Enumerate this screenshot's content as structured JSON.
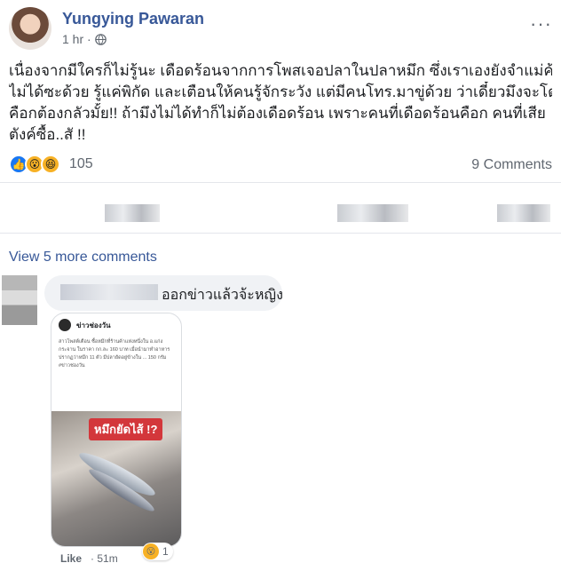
{
  "post": {
    "author": "Yungying Pawaran",
    "time": "1 hr ·",
    "more": "···",
    "lines": [
      "เนื่องจากมีใครก็ไม่รู้นะ เดือดร้อนจากการโพสเจอปลาในปลาหมึก ซึ่งเราเองยังจำแม่ค้า",
      "ไม่ได้ซะด้วย รู้แค่พิกัด และเตือนให้คนรู้จักระวัง แต่มีคนโทร.มาขู่ด้วย ว่าเดี๋ยวมึงจะโดน!!",
      "คือกต้องกลัวมั้ย!! ถ้ามึงไม่ได้ทำก็ไม่ต้องเดือดร้อน เพราะคนที่เดือดร้อนคือก คนที่เสีย",
      "ตังค์ซื้อ..สั !!"
    ],
    "reaction_count": "105",
    "comments_count": "9 Comments"
  },
  "reactions": {
    "like_icon": "thumbs-up-icon",
    "wow_icon": "wow-face-icon",
    "haha_icon": "haha-face-icon",
    "like_color": "#1877f2",
    "emoji_color": "#f7b125"
  },
  "comments": {
    "view_more": "View 5 more comments",
    "comment_text": "ออกข่าวแล้วจ้ะหญิง",
    "attachment_source": "ข่าวช่องวัน",
    "attachment_body": "สาวโพสต์เตือน ซื้อหมึกที่ร้านค้าแห่งหนึ่งใน อ.แก่งกระจาน ในราคา กก.ละ 160 บาท เมื่อนำมาทำอาหารปรากฏว่าหมึก 11 ตัว มีปลายัดอยู่ข้างใน ... 150 กรัม #ข่าวช่องวัน",
    "attachment_banner": "หมึกยัดไส้ !?",
    "like_label": "Like",
    "age": "· 51m",
    "reaction_count": "1",
    "reaction_icon": "wow-face-icon"
  }
}
